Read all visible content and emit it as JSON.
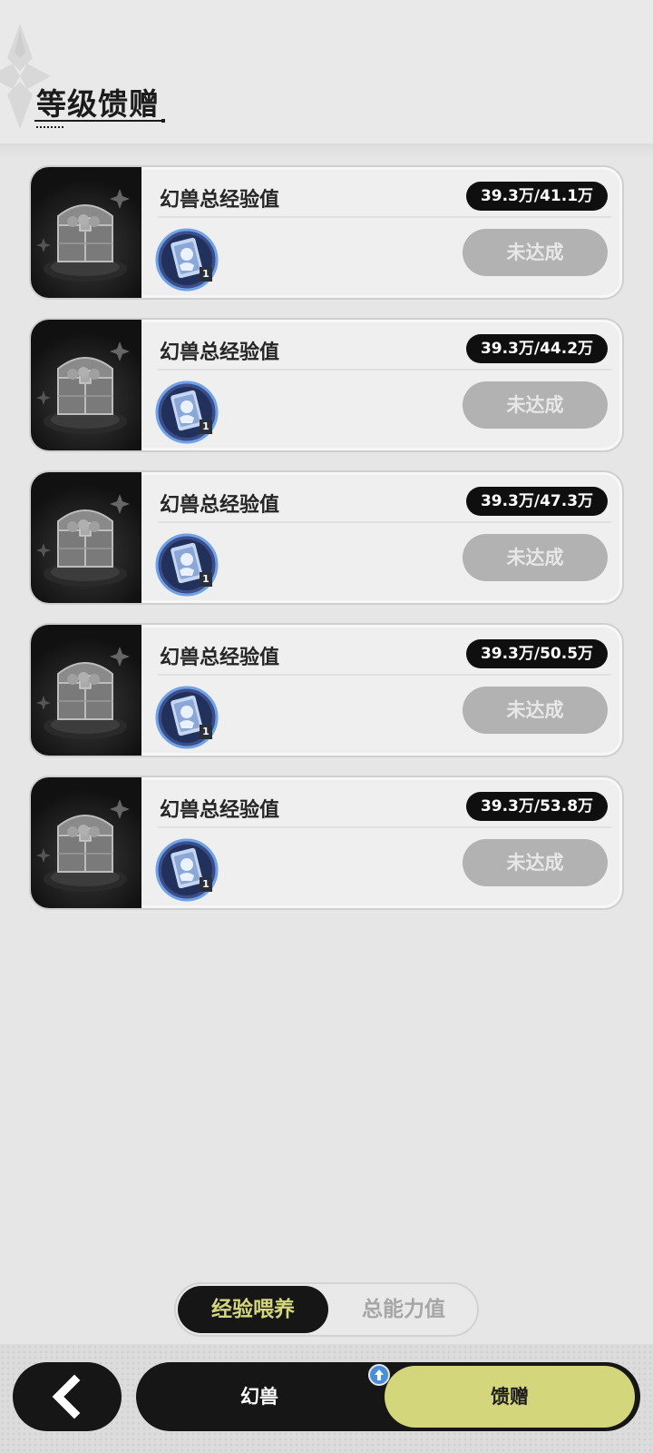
{
  "header": {
    "title": "等级馈赠"
  },
  "tasks": [
    {
      "title": "幻兽总经验值",
      "progress": "39.3万/41.1万",
      "reward_count": "1",
      "status": "未达成"
    },
    {
      "title": "幻兽总经验值",
      "progress": "39.3万/44.2万",
      "reward_count": "1",
      "status": "未达成"
    },
    {
      "title": "幻兽总经验值",
      "progress": "39.3万/47.3万",
      "reward_count": "1",
      "status": "未达成"
    },
    {
      "title": "幻兽总经验值",
      "progress": "39.3万/50.5万",
      "reward_count": "1",
      "status": "未达成"
    },
    {
      "title": "幻兽总经验值",
      "progress": "39.3万/53.8万",
      "reward_count": "1",
      "status": "未达成"
    }
  ],
  "subtabs": {
    "active": "经验喂养",
    "inactive": "总能力值"
  },
  "bottom_nav": {
    "beast_label": "幻兽",
    "gift_label": "馈赠"
  },
  "colors": {
    "accent": "#d4d67c",
    "dark": "#161616",
    "disabled_button": "#b2b2b2",
    "upgrade_badge": "#4a8fd8"
  },
  "icons": {
    "header_decoration": "diamond-ornament-icon",
    "card_thumbnail": "treasure-chest-icon",
    "reward": "character-card-icon",
    "back": "chevron-left-icon",
    "badge": "up-arrow-icon"
  }
}
